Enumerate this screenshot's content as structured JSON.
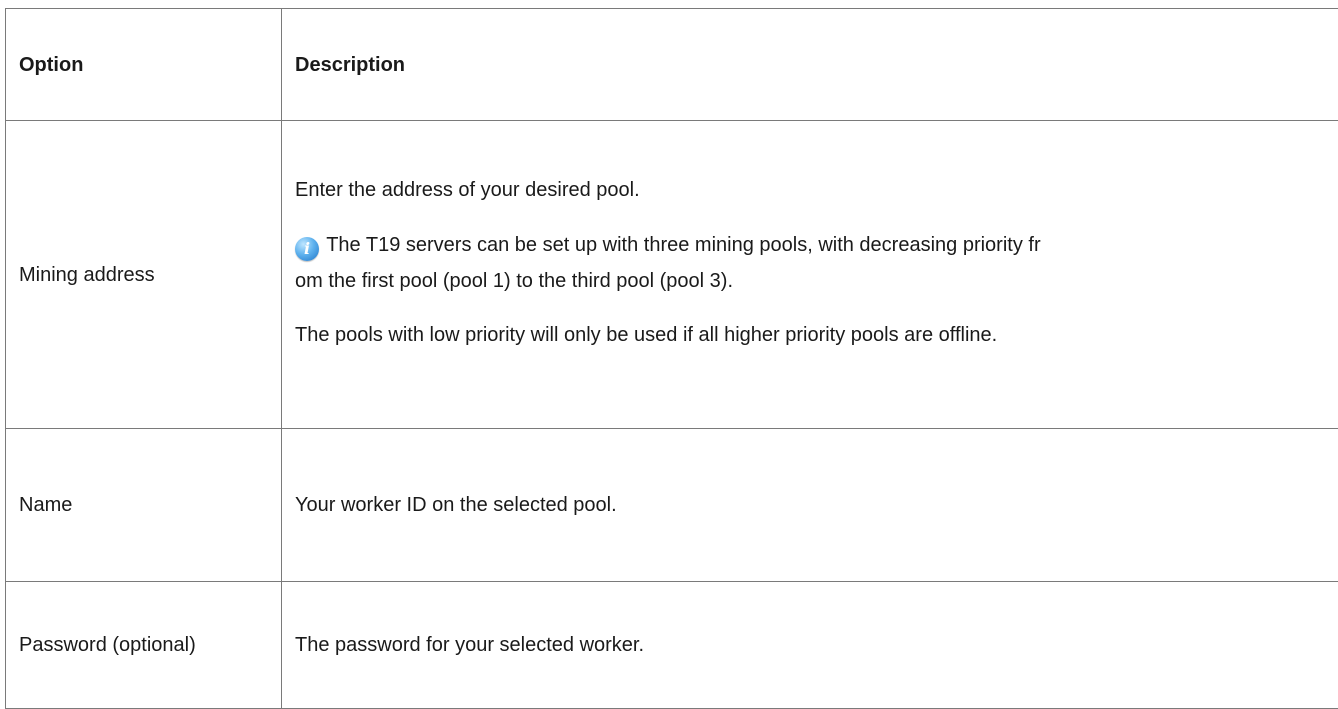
{
  "table": {
    "headers": {
      "option": "Option",
      "description": "Description"
    },
    "rows": {
      "mining": {
        "option": "Mining address",
        "desc_intro": "Enter the address of your desired pool.",
        "info_icon": "info-icon",
        "desc_note_line1": "The T19 servers can be set up with three mining pools, with decreasing priority fr",
        "desc_note_line2": "om the first pool (pool 1) to the third pool (pool 3).",
        "desc_fallback": "The pools with low priority will only be used if all higher priority pools are offline."
      },
      "name": {
        "option": "Name",
        "description": "Your worker ID on the selected pool."
      },
      "password": {
        "option": "Password (optional)",
        "description": "The password for your selected worker."
      }
    }
  },
  "colors": {
    "border": "#7a7a7a",
    "text": "#1a1a1a",
    "info_icon": "#3a8fd9"
  }
}
